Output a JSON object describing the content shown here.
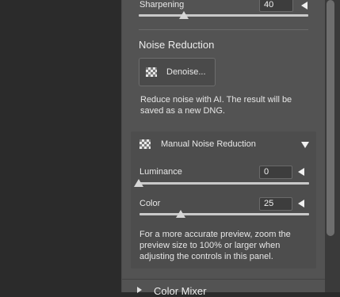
{
  "sharpening": {
    "label": "Sharpening",
    "value": "40",
    "level": 40
  },
  "noise_reduction": {
    "heading": "Noise Reduction",
    "denoise_label": "Denoise...",
    "description_line1": "Reduce noise with AI. The result will be",
    "description_line2": "saved as a new DNG."
  },
  "manual": {
    "title": "Manual Noise Reduction",
    "luminance": {
      "label": "Luminance",
      "value": "0",
      "level": 0
    },
    "color": {
      "label": "Color",
      "value": "25",
      "level": 25
    },
    "hint_line1": "For a more accurate preview, zoom the",
    "hint_line2": "preview size to 100% or larger when",
    "hint_line3": "adjusting the controls in this panel."
  },
  "next_section": {
    "label": "Color Mixer"
  },
  "icons": {
    "expand": "chevron-left-icon",
    "collapse": "triangle-down-icon",
    "denoise": "checkerboard-icon"
  }
}
